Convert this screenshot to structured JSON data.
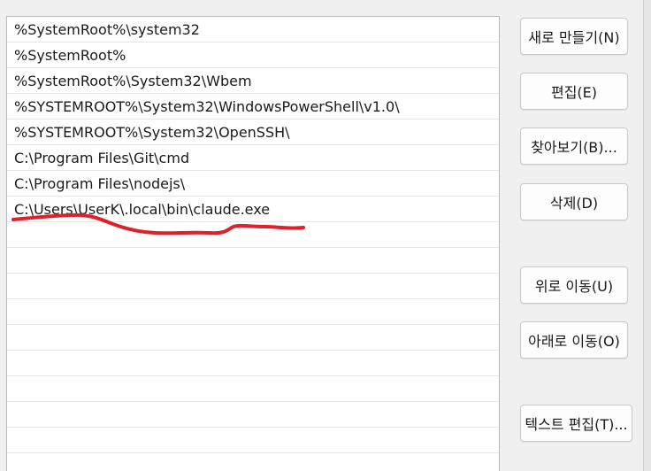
{
  "path_list": {
    "entries": [
      "%SystemRoot%\\system32",
      "%SystemRoot%",
      "%SystemRoot%\\System32\\Wbem",
      "%SYSTEMROOT%\\System32\\WindowsPowerShell\\v1.0\\",
      "%SYSTEMROOT%\\System32\\OpenSSH\\",
      "C:\\Program Files\\Git\\cmd",
      "C:\\Program Files\\nodejs\\",
      "C:\\Users\\UserK\\.local\\bin\\claude.exe"
    ],
    "highlighted_entry_index": 7,
    "annotation_color": "#e0202a"
  },
  "buttons": {
    "new": "새로 만들기(N)",
    "edit": "편집(E)",
    "browse": "찾아보기(B)...",
    "delete": "삭제(D)",
    "move_up": "위로 이동(U)",
    "move_down": "아래로 이동(O)",
    "edit_text": "텍스트 편집(T)..."
  }
}
